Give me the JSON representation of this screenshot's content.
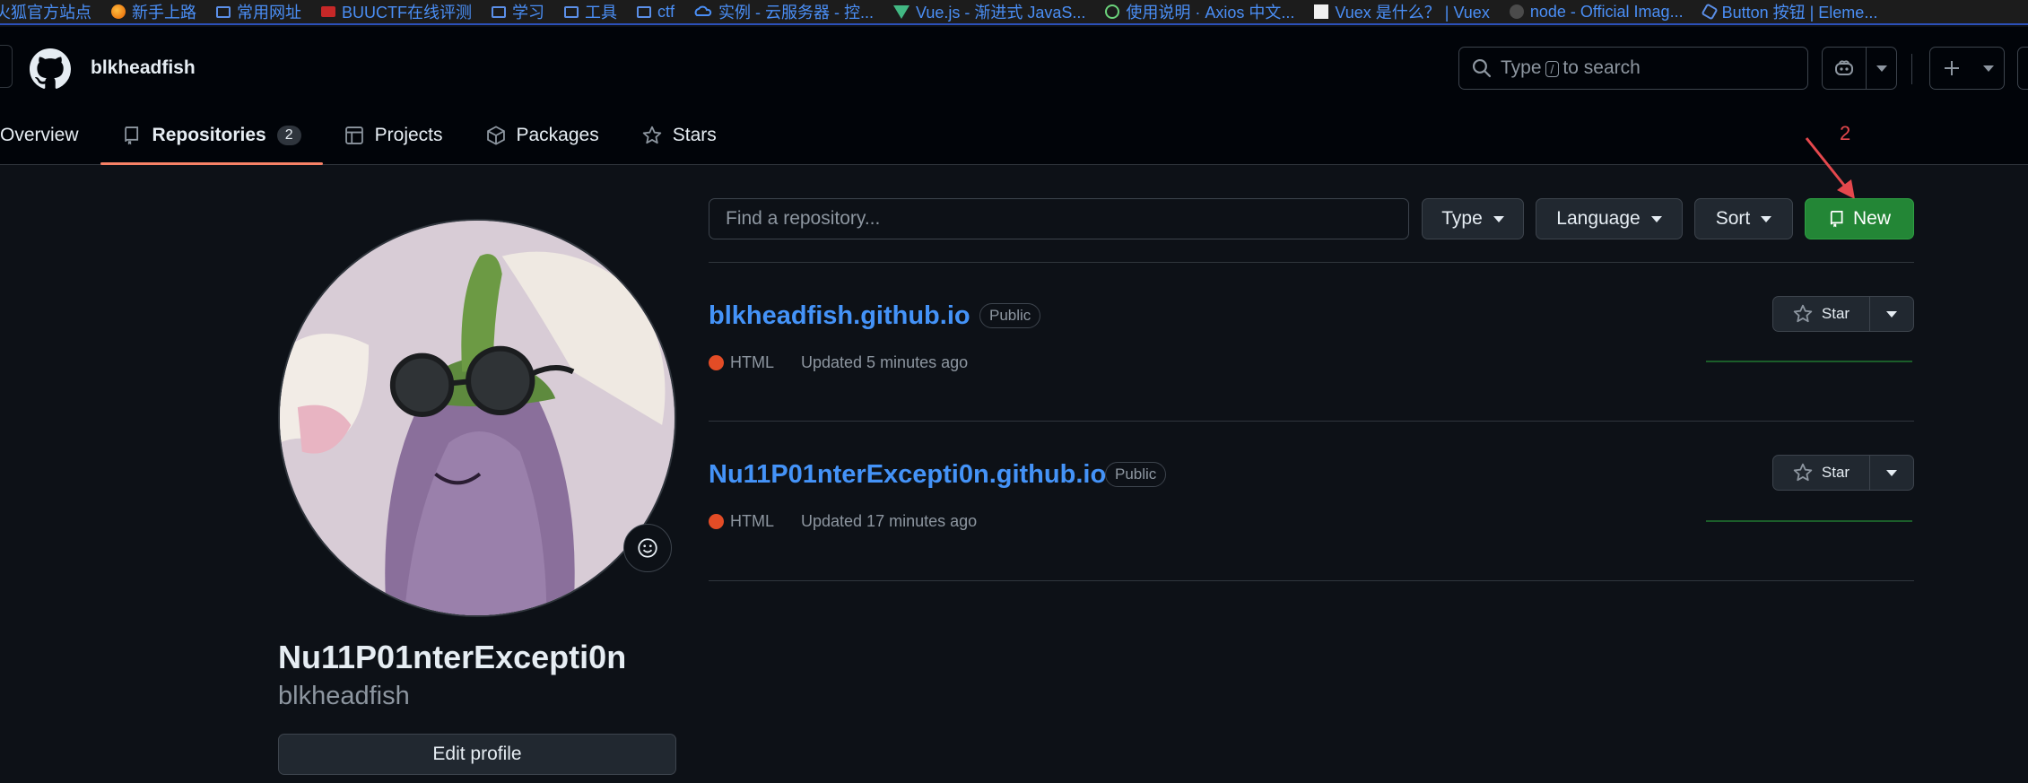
{
  "bookmarks": [
    {
      "label": "火狐官方站点",
      "icon": "firefox-icon"
    },
    {
      "label": "新手上路",
      "icon": "firefox-icon"
    },
    {
      "label": "常用网址",
      "icon": "folder-icon"
    },
    {
      "label": "BUUCTF在线评测",
      "icon": "buuctf-icon"
    },
    {
      "label": "学习",
      "icon": "folder-icon"
    },
    {
      "label": "工具",
      "icon": "folder-icon"
    },
    {
      "label": "ctf",
      "icon": "folder-icon"
    },
    {
      "label": "实例 - 云服务器 - 控...",
      "icon": "cloud-icon"
    },
    {
      "label": "Vue.js - 渐进式 JavaS...",
      "icon": "vue-icon"
    },
    {
      "label": "使用说明 · Axios 中文...",
      "icon": "axios-icon"
    },
    {
      "label": "Vuex 是什么？ | Vuex",
      "icon": "vuex-icon"
    },
    {
      "label": "node - Official Imag...",
      "icon": "docker-icon"
    },
    {
      "label": "Button 按钮 | Eleme...",
      "icon": "element-icon"
    }
  ],
  "header": {
    "owner": "blkheadfish",
    "search_prefix": "Type",
    "search_key": "/",
    "search_suffix": "to search"
  },
  "tabs": [
    {
      "label": "Overview",
      "icon": "book-icon"
    },
    {
      "label": "Repositories",
      "icon": "repo-icon",
      "count": "2"
    },
    {
      "label": "Projects",
      "icon": "table-icon"
    },
    {
      "label": "Packages",
      "icon": "package-icon"
    },
    {
      "label": "Stars",
      "icon": "star-icon"
    }
  ],
  "annotation": "2",
  "profile": {
    "full_name": "Nu11P01nterExcepti0n",
    "login": "blkheadfish",
    "edit_label": "Edit profile"
  },
  "filters": {
    "find_placeholder": "Find a repository...",
    "type_label": "Type",
    "language_label": "Language",
    "sort_label": "Sort",
    "new_label": "New"
  },
  "repos": [
    {
      "name": "blkheadfish.github.io",
      "visibility": "Public",
      "language": "HTML",
      "language_color": "#e34c26",
      "updated": "Updated 5 minutes ago",
      "star_label": "Star"
    },
    {
      "name": "Nu11P01nterExcepti0n.github.io",
      "visibility": "Public",
      "language": "HTML",
      "language_color": "#e34c26",
      "updated": "Updated 17 minutes ago",
      "star_label": "Star"
    }
  ],
  "colors": {
    "accent": "#4493f8",
    "new_button": "#238636",
    "tab_underline": "#f78166",
    "annotation": "#e5484d"
  }
}
